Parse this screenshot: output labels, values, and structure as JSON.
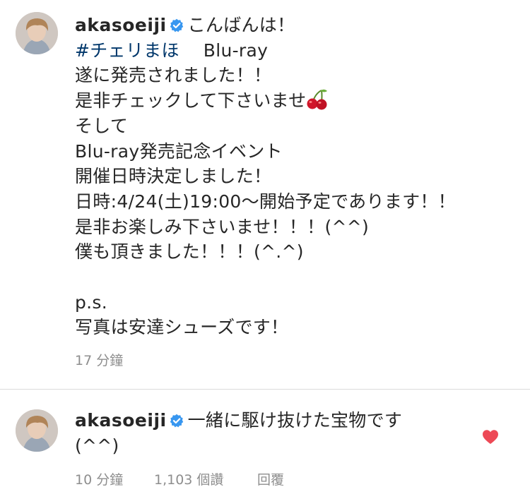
{
  "post": {
    "username": "akasoeiji",
    "lines": [
      "こんばんは！",
      "#チェリまほ",
      "Blu-ray",
      "遂に発売されました！！",
      "是非チェックして下さいませ",
      "そして",
      "Blu-ray発売記念イベント",
      "開催日時決定しました！",
      "日時:4/24(土)19:00〜開始予定であります！！",
      "是非お楽しみ下さいませ！！！(^^)",
      "僕も頂きました！！！(^.^)",
      "p.s.",
      "写真は安達シューズです！"
    ],
    "emoji": "cherry-emoji",
    "timestamp": "17 分鐘"
  },
  "comment": {
    "username": "akasoeiji",
    "text_line1": "一緒に駆け抜けた宝物です",
    "text_line2": "(^^)",
    "timestamp": "10 分鐘",
    "likes": "1,103 個讚",
    "reply_label": "回覆",
    "liked": true
  },
  "colors": {
    "text": "#262626",
    "hashtag": "#00376b",
    "meta": "#8e8e8e",
    "verified": "#3897f0",
    "heart": "#ed4956"
  }
}
